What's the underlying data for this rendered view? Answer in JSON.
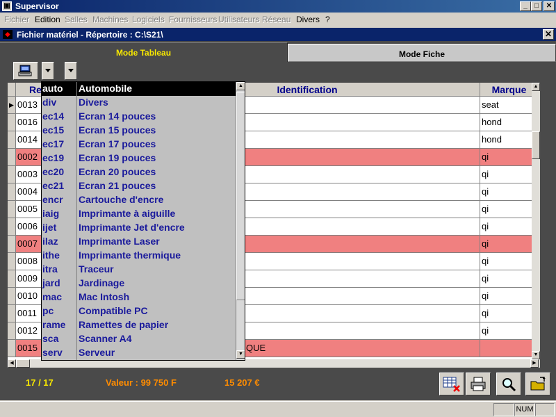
{
  "window": {
    "title": "Supervisor",
    "buttons": {
      "minimize": "_",
      "maximize": "□",
      "close": "✕"
    }
  },
  "menu": [
    {
      "label": "Fichier",
      "enabled": false
    },
    {
      "label": "Edition",
      "enabled": true
    },
    {
      "label": "Salles",
      "enabled": false
    },
    {
      "label": "Machines",
      "enabled": false
    },
    {
      "label": "Logiciels",
      "enabled": false
    },
    {
      "label": "Fournisseurs",
      "enabled": false
    },
    {
      "label": "Utilisateurs",
      "enabled": false
    },
    {
      "label": "Réseau",
      "enabled": false
    },
    {
      "label": "Divers",
      "enabled": true
    },
    {
      "label": "?",
      "enabled": true
    }
  ],
  "document": {
    "title": "Fichier matériel - Répertoire : C:\\S21\\"
  },
  "tabs": {
    "active": "Mode Tableau",
    "inactive": "Mode Fiche"
  },
  "grid": {
    "headers": {
      "ref": "Re",
      "identification": "Identification",
      "marque": "Marque"
    },
    "rows": [
      {
        "ref": "0013",
        "ident": "",
        "marque": "seat",
        "hl": false,
        "current": true
      },
      {
        "ref": "0016",
        "ident": "",
        "marque": "hond",
        "hl": false,
        "current": false
      },
      {
        "ref": "0014",
        "ident": "",
        "marque": "hond",
        "hl": false,
        "current": false
      },
      {
        "ref": "0002",
        "ident": "",
        "marque": "qi",
        "hl": true,
        "current": false
      },
      {
        "ref": "0003",
        "ident": "",
        "marque": "qi",
        "hl": false,
        "current": false
      },
      {
        "ref": "0004",
        "ident": "",
        "marque": "qi",
        "hl": false,
        "current": false
      },
      {
        "ref": "0005",
        "ident": "",
        "marque": "qi",
        "hl": false,
        "current": false
      },
      {
        "ref": "0006",
        "ident": "",
        "marque": "qi",
        "hl": false,
        "current": false
      },
      {
        "ref": "0007",
        "ident": "",
        "marque": "qi",
        "hl": true,
        "current": false
      },
      {
        "ref": "0008",
        "ident": "",
        "marque": "qi",
        "hl": false,
        "current": false
      },
      {
        "ref": "0009",
        "ident": "",
        "marque": "qi",
        "hl": false,
        "current": false
      },
      {
        "ref": "0010",
        "ident": "",
        "marque": "qi",
        "hl": false,
        "current": false
      },
      {
        "ref": "0011",
        "ident": "",
        "marque": "qi",
        "hl": false,
        "current": false
      },
      {
        "ref": "0012",
        "ident": "",
        "marque": "qi",
        "hl": false,
        "current": false
      },
      {
        "ref": "0015",
        "ident": "QUE",
        "marque": "",
        "hl": true,
        "current": false
      }
    ]
  },
  "dropdown": {
    "header": {
      "code": "auto",
      "label": "Automobile"
    },
    "items": [
      {
        "code": "div",
        "label": "Divers"
      },
      {
        "code": "ec14",
        "label": "Ecran 14 pouces"
      },
      {
        "code": "ec15",
        "label": "Ecran 15 pouces"
      },
      {
        "code": "ec17",
        "label": "Ecran 17 pouces"
      },
      {
        "code": "ec19",
        "label": "Ecran 19 pouces"
      },
      {
        "code": "ec20",
        "label": "Ecran 20 pouces"
      },
      {
        "code": "ec21",
        "label": "Ecran 21 pouces"
      },
      {
        "code": "encr",
        "label": "Cartouche d'encre"
      },
      {
        "code": "iaig",
        "label": "Imprimante à aiguille"
      },
      {
        "code": "ijet",
        "label": "Imprimante Jet d'encre"
      },
      {
        "code": "ilaz",
        "label": "Imprimante Laser"
      },
      {
        "code": "ithe",
        "label": "Imprimante thermique"
      },
      {
        "code": "itra",
        "label": "Traceur"
      },
      {
        "code": "jard",
        "label": "Jardinage"
      },
      {
        "code": "mac",
        "label": "Mac Intosh"
      },
      {
        "code": "pc",
        "label": "Compatible PC"
      },
      {
        "code": "rame",
        "label": "Ramettes de papier"
      },
      {
        "code": "sca",
        "label": "Scanner A4"
      },
      {
        "code": "serv",
        "label": "Serveur"
      }
    ]
  },
  "footer": {
    "count": "17 / 17",
    "valeur": "Valeur : 99 750 F",
    "euros": "15 207 €"
  },
  "colors": {
    "accent_yellow": "#f8e800",
    "orange": "#ff8c00",
    "highlight_row": "#f08080",
    "title_blue": "#0a246a"
  },
  "status": {
    "num": "NUM"
  },
  "icons": [
    "computer-icon",
    "chevron-down-icon",
    "delete-record-icon",
    "printer-icon",
    "search-icon",
    "open-folder-icon"
  ]
}
